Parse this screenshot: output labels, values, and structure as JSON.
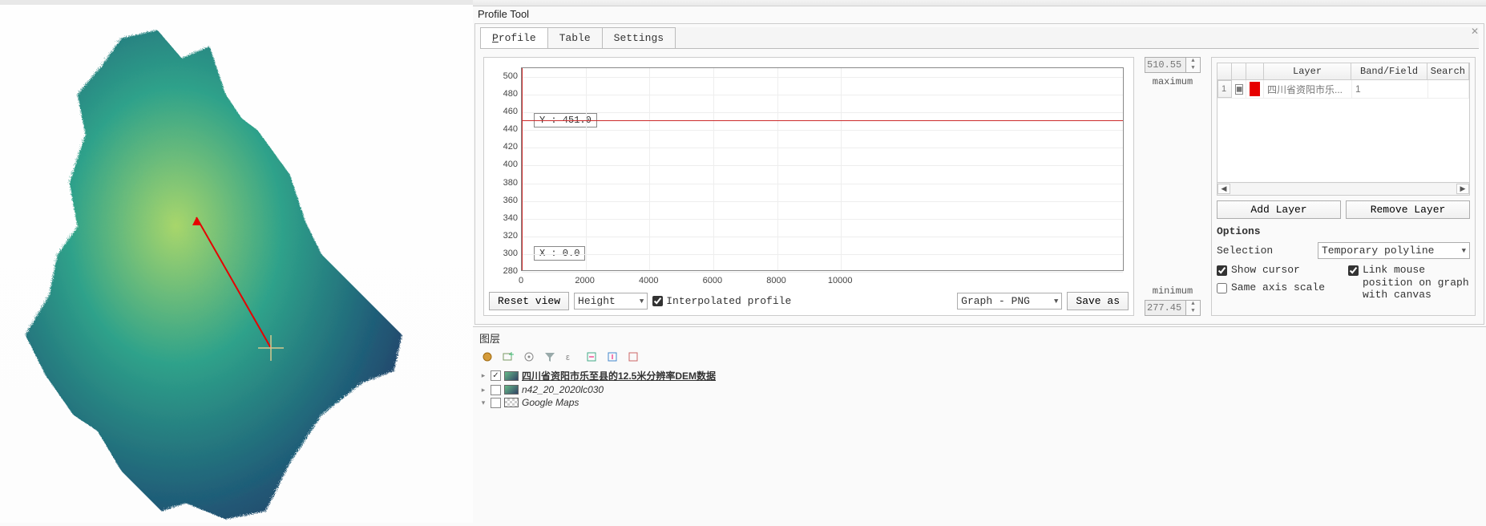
{
  "panel_title": "Profile Tool",
  "tabs": {
    "profile": "Profile",
    "table": "Table",
    "settings": "Settings"
  },
  "chart_data": {
    "type": "line",
    "x": [
      0,
      2000,
      4000,
      6000,
      8000,
      10000
    ],
    "series": [],
    "xlabel": "",
    "ylabel": "",
    "xlim": [
      0,
      11000
    ],
    "ylim": [
      280,
      510
    ],
    "yticks": [
      280,
      300,
      320,
      340,
      360,
      380,
      400,
      420,
      440,
      460,
      480,
      500
    ],
    "xticks": [
      0,
      2000,
      4000,
      6000,
      8000,
      10000
    ],
    "cursor": {
      "x": 0.0,
      "y": 451.0,
      "x_label": "X : 0.0",
      "y_label": "Y : 451.0"
    }
  },
  "spin": {
    "max_value": "510.55",
    "max_label": "maximum",
    "min_value": "277.45",
    "min_label": "minimum"
  },
  "chart_controls": {
    "reset": "Reset view",
    "mode": "Height",
    "interpolated": "Interpolated profile",
    "export": "Graph - PNG",
    "save": "Save as"
  },
  "layer_table": {
    "headers": [
      "",
      "",
      "Layer",
      "Band/Field",
      "Search"
    ],
    "rows": [
      {
        "idx": "1",
        "name": "四川省资阳市乐...",
        "band": "1"
      }
    ]
  },
  "layer_buttons": {
    "add": "Add Layer",
    "remove": "Remove Layer"
  },
  "options": {
    "title": "Options",
    "selection_label": "Selection",
    "selection_value": "Temporary polyline",
    "show_cursor": "Show cursor",
    "link_mouse": "Link mouse position on graph with canvas",
    "same_axis": "Same axis scale"
  },
  "layers_panel": {
    "title": "图层",
    "items": [
      {
        "expanded": "▸",
        "checked": true,
        "label": "四川省资阳市乐至县的12.5米分辨率DEM数据",
        "bold": true,
        "thumb": "dem"
      },
      {
        "expanded": "▸",
        "checked": false,
        "label": "n42_20_2020lc030",
        "italic": true,
        "thumb": "dem"
      },
      {
        "expanded": "▾",
        "checked": false,
        "label": "Google Maps",
        "italic": true,
        "thumb": "gm"
      }
    ]
  }
}
